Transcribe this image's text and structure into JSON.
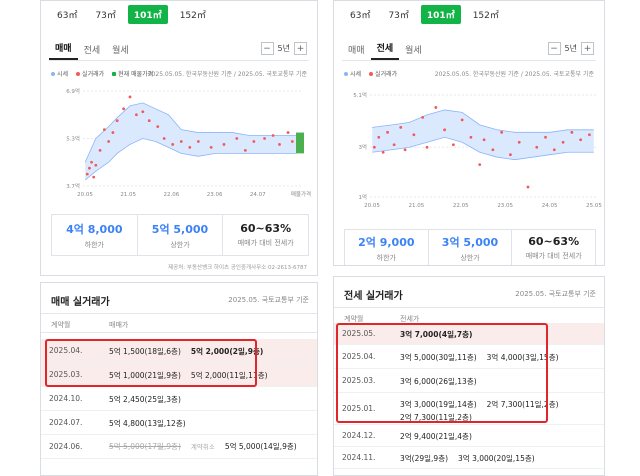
{
  "colors": {
    "accent": "#12b347",
    "actual": "#f05a5a",
    "market_band": "#cfe3ff",
    "market_line": "#8ab4f8",
    "blue_value": "#3b82f6",
    "highlight": "#e0262b"
  },
  "left_top": {
    "size_tabs": [
      {
        "label": "63㎡"
      },
      {
        "label": "73㎡"
      },
      {
        "label": "101㎡",
        "active": true
      },
      {
        "label": "152㎡"
      }
    ],
    "trade_tabs": [
      {
        "label": "매매",
        "active": true
      },
      {
        "label": "전세"
      },
      {
        "label": "월세"
      }
    ],
    "period": {
      "minus": "−",
      "value": "5년",
      "plus": "+"
    },
    "legend": [
      {
        "label": "시세"
      },
      {
        "label": "실거래가"
      },
      {
        "label": "현재 매물가격"
      }
    ],
    "source": "2025.05.05. 한국부동산원 기준 / 2025.05. 국토교통부 기준",
    "stats": [
      {
        "value": "4억 8,000",
        "label": "하한가"
      },
      {
        "value": "5억 5,000",
        "label": "상한가"
      },
      {
        "value": "60~63%",
        "label": "매매가 대비 전세가"
      }
    ],
    "footnote": "제공처: 부동산뱅크 하이츠 공인중개사무소 02-2613-6787"
  },
  "right_top": {
    "size_tabs": [
      {
        "label": "63㎡"
      },
      {
        "label": "73㎡"
      },
      {
        "label": "101㎡",
        "active": true
      },
      {
        "label": "152㎡"
      }
    ],
    "trade_tabs": [
      {
        "label": "매매"
      },
      {
        "label": "전세",
        "active": true
      },
      {
        "label": "월세"
      }
    ],
    "period": {
      "minus": "−",
      "value": "5년",
      "plus": "+"
    },
    "legend": [
      {
        "label": "시세"
      },
      {
        "label": "실거래가"
      }
    ],
    "source": "2025.05.05. 한국부동산원 기준 / 2025.05. 국토교통부 기준",
    "stats": [
      {
        "value": "2억 9,000",
        "label": "하한가"
      },
      {
        "value": "3억 5,000",
        "label": "상한가"
      },
      {
        "value": "60~63%",
        "label": "매매가 대비 전세가"
      }
    ]
  },
  "chart_data": [
    {
      "type": "scatter",
      "title": "",
      "ylabels": [
        "6.9억",
        "5.3억",
        "3.7억"
      ],
      "yticks": [
        6.9,
        5.3,
        3.7
      ],
      "ylim": [
        3.7,
        6.9
      ],
      "xlabels": [
        "20.05",
        "21.05",
        "22.06",
        "23.06",
        "24.07",
        "매물가격"
      ],
      "xlim": [
        2020.3,
        2025.45
      ],
      "band": {
        "x": [
          2020.35,
          2020.6,
          2020.9,
          2021.1,
          2021.4,
          2021.7,
          2022.0,
          2022.3,
          2022.6,
          2023.0,
          2023.4,
          2023.8,
          2024.2,
          2024.6,
          2025.0,
          2025.3
        ],
        "upper": [
          4.5,
          5.3,
          5.7,
          6.0,
          6.4,
          6.5,
          6.3,
          6.1,
          5.6,
          5.5,
          5.5,
          5.5,
          5.4,
          5.4,
          5.4,
          5.4
        ],
        "lower": [
          3.9,
          4.2,
          4.5,
          4.8,
          5.1,
          5.3,
          5.2,
          5.0,
          4.8,
          4.7,
          4.8,
          4.8,
          4.8,
          4.8,
          4.8,
          4.8
        ]
      },
      "actual_points": [
        [
          2020.4,
          4.1
        ],
        [
          2020.45,
          4.3
        ],
        [
          2020.5,
          4.5
        ],
        [
          2020.55,
          4.0
        ],
        [
          2020.6,
          4.4
        ],
        [
          2020.7,
          4.9
        ],
        [
          2020.8,
          5.6
        ],
        [
          2020.9,
          5.2
        ],
        [
          2021.0,
          5.5
        ],
        [
          2021.1,
          5.9
        ],
        [
          2021.25,
          6.3
        ],
        [
          2021.4,
          6.7
        ],
        [
          2021.55,
          6.1
        ],
        [
          2021.7,
          6.2
        ],
        [
          2021.85,
          5.9
        ],
        [
          2022.05,
          5.7
        ],
        [
          2022.2,
          5.3
        ],
        [
          2022.4,
          5.1
        ],
        [
          2022.6,
          5.2
        ],
        [
          2022.8,
          5.0
        ],
        [
          2023.0,
          5.2
        ],
        [
          2023.3,
          5.0
        ],
        [
          2023.6,
          5.1
        ],
        [
          2023.9,
          5.3
        ],
        [
          2024.1,
          4.9
        ],
        [
          2024.3,
          5.2
        ],
        [
          2024.55,
          5.3
        ],
        [
          2024.75,
          5.4
        ],
        [
          2024.9,
          5.1
        ],
        [
          2025.1,
          5.5
        ],
        [
          2025.2,
          5.2
        ]
      ],
      "listing_range": [
        4.8,
        5.5
      ]
    },
    {
      "type": "scatter",
      "title": "",
      "ylabels": [
        "5.1억",
        "3억",
        "1억"
      ],
      "yticks": [
        5.1,
        3.0,
        1.0
      ],
      "ylim": [
        1.0,
        5.1
      ],
      "xlabels": [
        "20.05",
        "21.05",
        "22.05",
        "23.05",
        "24.05",
        "25.05"
      ],
      "xlim": [
        2020.3,
        2025.45
      ],
      "band": {
        "x": [
          2020.35,
          2020.8,
          2021.2,
          2021.6,
          2022.0,
          2022.4,
          2022.8,
          2023.2,
          2023.6,
          2024.0,
          2024.4,
          2024.8,
          2025.2,
          2025.4
        ],
        "upper": [
          3.8,
          3.9,
          4.0,
          4.3,
          4.5,
          4.4,
          3.9,
          3.7,
          3.6,
          3.6,
          3.6,
          3.7,
          3.7,
          3.7
        ],
        "lower": [
          2.8,
          2.9,
          3.0,
          3.2,
          3.4,
          3.2,
          2.8,
          2.6,
          2.5,
          2.6,
          2.7,
          2.8,
          2.8,
          2.8
        ]
      },
      "actual_points": [
        [
          2020.4,
          3.0
        ],
        [
          2020.5,
          3.4
        ],
        [
          2020.6,
          2.8
        ],
        [
          2020.7,
          3.6
        ],
        [
          2020.85,
          3.1
        ],
        [
          2021.0,
          3.8
        ],
        [
          2021.1,
          2.9
        ],
        [
          2021.3,
          3.5
        ],
        [
          2021.5,
          4.2
        ],
        [
          2021.6,
          3.0
        ],
        [
          2021.8,
          4.6
        ],
        [
          2022.0,
          3.7
        ],
        [
          2022.2,
          3.1
        ],
        [
          2022.4,
          4.1
        ],
        [
          2022.6,
          3.4
        ],
        [
          2022.8,
          2.3
        ],
        [
          2022.9,
          3.3
        ],
        [
          2023.1,
          2.9
        ],
        [
          2023.3,
          3.6
        ],
        [
          2023.5,
          2.7
        ],
        [
          2023.7,
          3.2
        ],
        [
          2023.9,
          1.4
        ],
        [
          2024.1,
          3.0
        ],
        [
          2024.3,
          3.4
        ],
        [
          2024.5,
          2.9
        ],
        [
          2024.7,
          3.2
        ],
        [
          2024.9,
          3.6
        ],
        [
          2025.1,
          3.3
        ],
        [
          2025.3,
          3.5
        ]
      ]
    }
  ],
  "sale_table": {
    "title": "매매 실거래가",
    "source": "2025.05. 국토교통부 기준",
    "col_date": "계약월",
    "col_price": "매매가",
    "rows": [
      {
        "date": "2025.04.",
        "hl": true,
        "prices": [
          {
            "t": "5억 1,500(18일,6층)"
          },
          {
            "t": "5억 2,000(2일,9층)",
            "bold": true
          }
        ]
      },
      {
        "date": "2025.03.",
        "hl": true,
        "prices": [
          {
            "t": "5억 1,000(21일,9층)"
          },
          {
            "t": "5억 2,000(11일,11층)"
          }
        ]
      },
      {
        "date": "2024.10.",
        "prices": [
          {
            "t": "5억 2,450(25일,3층)"
          }
        ]
      },
      {
        "date": "2024.07.",
        "prices": [
          {
            "t": "5억 4,800(13일,12층)"
          }
        ]
      },
      {
        "date": "2024.06.",
        "prices": [
          {
            "t": "5억 5,000(17일,9층)",
            "strike": true
          },
          {
            "t": "계약취소",
            "canc": true
          },
          {
            "t": "5억 5,000(14일,9층)"
          }
        ]
      }
    ]
  },
  "jeonse_table": {
    "title": "전세 실거래가",
    "source": "2025.05. 국토교통부 기준",
    "col_date": "계약월",
    "col_price": "전세가",
    "rows": [
      {
        "date": "2025.05.",
        "hl": true,
        "prices": [
          {
            "t": "3억 7,000(4일,7층)",
            "bold": true
          }
        ]
      },
      {
        "date": "2025.04.",
        "prices": [
          {
            "t": "3억 5,000(30일,11층)"
          },
          {
            "t": "3억 4,000(3일,15층)"
          }
        ]
      },
      {
        "date": "2025.03.",
        "prices": [
          {
            "t": "3억 6,000(26일,13층)"
          }
        ]
      },
      {
        "date": "2025.01.",
        "prices": [
          {
            "t": "3억 3,000(19일,14층)"
          },
          {
            "t": "2억 7,300(11일,2층)"
          },
          {
            "t": "2억 7,300(11일,2층)"
          }
        ]
      },
      {
        "date": "2024.12.",
        "prices": [
          {
            "t": "2억 9,400(21일,4층)"
          }
        ]
      },
      {
        "date": "2024.11.",
        "prices": [
          {
            "t": "3억(29일,9층)"
          },
          {
            "t": "3억 3,000(20일,15층)"
          }
        ]
      }
    ]
  }
}
